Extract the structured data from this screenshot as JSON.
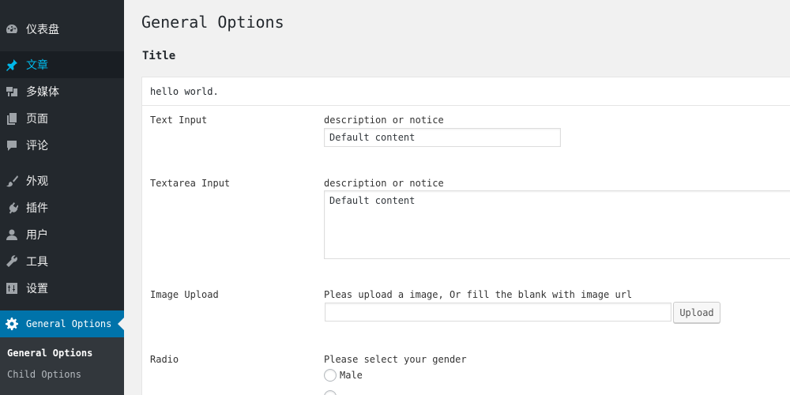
{
  "sidebar": {
    "items": [
      {
        "label": "仪表盘",
        "icon": "dashboard-icon"
      },
      {
        "label": "文章",
        "icon": "pin-icon"
      },
      {
        "label": "多媒体",
        "icon": "media-icon"
      },
      {
        "label": "页面",
        "icon": "pages-icon"
      },
      {
        "label": "评论",
        "icon": "comment-icon"
      },
      {
        "label": "外观",
        "icon": "brush-icon"
      },
      {
        "label": "插件",
        "icon": "plugin-icon"
      },
      {
        "label": "用户",
        "icon": "user-icon"
      },
      {
        "label": "工具",
        "icon": "wrench-icon"
      },
      {
        "label": "设置",
        "icon": "settings-icon"
      },
      {
        "label": "General Options",
        "icon": "gear-icon"
      }
    ],
    "submenu": [
      "General Options",
      "Child Options"
    ]
  },
  "main": {
    "page_title": "General Options",
    "section_title": "Title",
    "panel_header": "hello world.",
    "fields": {
      "text_input": {
        "label": "Text Input",
        "description": "description or notice",
        "value": "Default content"
      },
      "textarea_input": {
        "label": "Textarea Input",
        "description": "description or notice",
        "value": "Default content"
      },
      "image_upload": {
        "label": "Image Upload",
        "description": "Pleas upload a image, Or fill the blank with image url",
        "value": "",
        "button": "Upload"
      },
      "radio": {
        "label": "Radio",
        "description": "Please select your gender",
        "options": [
          "Male"
        ]
      }
    }
  },
  "colors": {
    "sidebar_bg": "#23282d",
    "active_bg": "#0073aa",
    "current_text": "#00b9eb",
    "page_bg": "#f1f1f1"
  }
}
